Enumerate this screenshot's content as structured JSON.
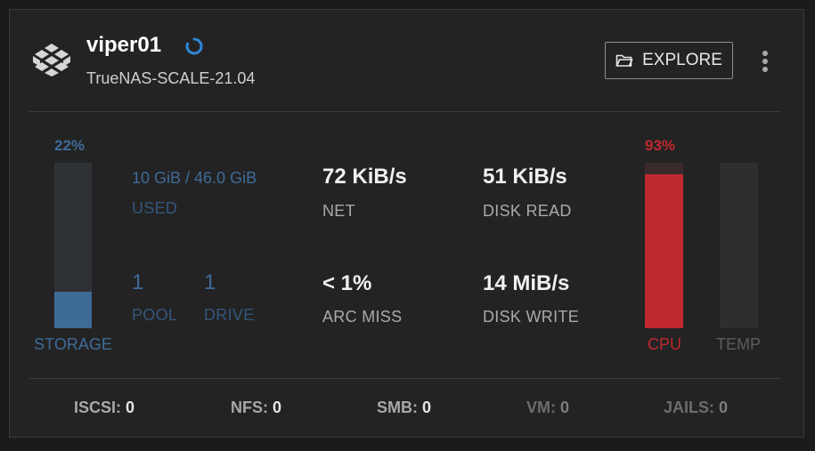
{
  "system": {
    "hostname": "viper01",
    "version": "TrueNAS-SCALE-21.04"
  },
  "actions": {
    "explore_label": "EXPLORE"
  },
  "storage": {
    "percent_label": "22%",
    "percent_value": 22,
    "used_value": "10 GiB / 46.0 GiB",
    "used_label": "USED",
    "pool_count": "1",
    "pool_label": "POOL",
    "drive_count": "1",
    "drive_label": "DRIVE",
    "bar_label": "STORAGE"
  },
  "stats": {
    "net_value": "72 KiB/s",
    "net_label": "NET",
    "disk_read_value": "51 KiB/s",
    "disk_read_label": "DISK READ",
    "arc_miss_value": "< 1%",
    "arc_miss_label": "ARC MISS",
    "disk_write_value": "14 MiB/s",
    "disk_write_label": "DISK WRITE"
  },
  "cpu": {
    "percent_label": "93%",
    "percent_value": 93,
    "bar_label": "CPU"
  },
  "temp": {
    "bar_label": "TEMP"
  },
  "services": [
    {
      "label": "ISCSI:",
      "value": "0"
    },
    {
      "label": "NFS:",
      "value": "0"
    },
    {
      "label": "SMB:",
      "value": "0"
    },
    {
      "label": "VM:",
      "value": "0"
    },
    {
      "label": "JAILS:",
      "value": "0"
    }
  ],
  "colors": {
    "storage_accent": "#3f6b98",
    "cpu_accent": "#c0282f",
    "spinner": "#2f87d6"
  },
  "icons": {
    "logo": "truenas-logo-icon",
    "spinner": "loading-spinner-icon",
    "explore": "folder-open-icon",
    "menu": "more-vertical-icon"
  }
}
